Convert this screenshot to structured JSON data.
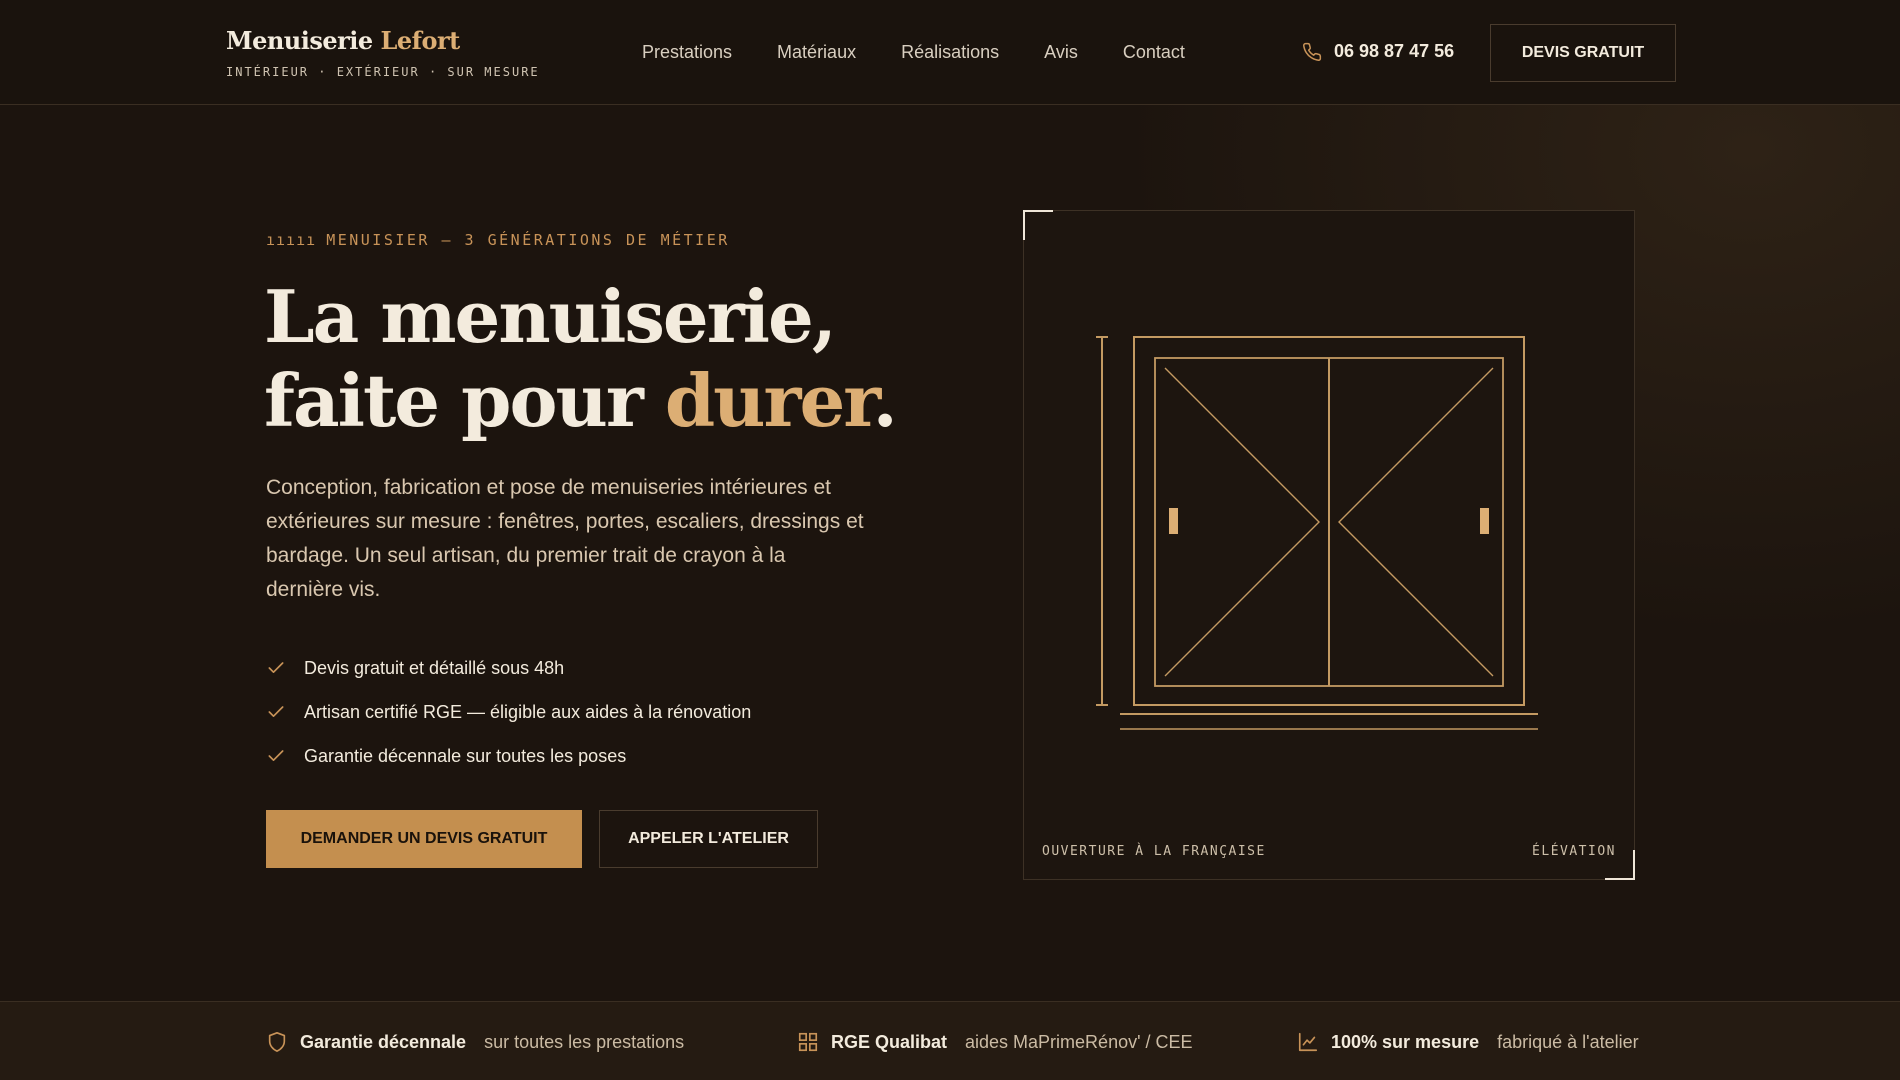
{
  "header": {
    "brand_name": "Menuiserie",
    "brand_accent": "Lefort",
    "brand_tagline": "INTÉRIEUR · EXTÉRIEUR · SUR MESURE",
    "nav": [
      "Prestations",
      "Matériaux",
      "Réalisations",
      "Avis",
      "Contact"
    ],
    "phone": "06 98 87 47 56",
    "cta": "DEVIS GRATUIT"
  },
  "hero": {
    "eyebrow": "MENUISIER — 3 GÉNÉRATIONS DE MÉTIER",
    "title_line1": "La menuiserie,",
    "title_line2_prefix": "faite pour ",
    "title_accent": "durer",
    "title_suffix": ".",
    "lead": "Conception, fabrication et pose de menuiseries intérieures et extérieures sur mesure : fenêtres, portes, escaliers, dressings et bardage. Un seul artisan, du premier trait de crayon à la dernière vis.",
    "features": [
      "Devis gratuit et détaillé sous 48h",
      "Artisan certifié RGE — éligible aux aides à la rénovation",
      "Garantie décennale sur toutes les poses"
    ],
    "primary_cta": "DEMANDER UN DEVIS GRATUIT",
    "secondary_cta": "APPELER L'ATELIER"
  },
  "illustration": {
    "caption_left": "OUVERTURE À LA FRANÇAISE",
    "caption_right": "ÉLÉVATION"
  },
  "trust_strip": [
    {
      "icon": "shield-icon",
      "title": "Garantie décennale",
      "subtitle": "sur toutes les prestations"
    },
    {
      "icon": "grid-icon",
      "title": "RGE Qualibat",
      "subtitle": "aides MaPrimeRénov' / CEE"
    },
    {
      "icon": "chart-icon",
      "title": "100% sur mesure",
      "subtitle": "fabriqué à l'atelier"
    }
  ],
  "colors": {
    "background": "#1c140e",
    "accent": "#c48f4f",
    "accent_light": "#dcae74",
    "text": "#f3ebdd"
  }
}
